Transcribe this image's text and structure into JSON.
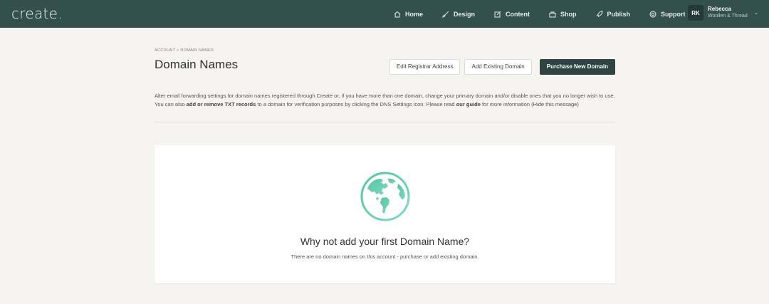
{
  "header": {
    "logo": "create.",
    "nav": [
      {
        "label": "Home",
        "icon": "home-icon"
      },
      {
        "label": "Design",
        "icon": "brush-icon"
      },
      {
        "label": "Content",
        "icon": "edit-icon"
      },
      {
        "label": "Shop",
        "icon": "shop-icon"
      },
      {
        "label": "Publish",
        "icon": "rocket-icon"
      },
      {
        "label": "Support",
        "icon": "support-icon"
      }
    ],
    "user": {
      "initials": "RK",
      "name": "Rebecca",
      "site": "Woollen & Thread"
    }
  },
  "page": {
    "breadcrumb": "ACCOUNT > DOMAIN NAMES",
    "title": "Domain Names",
    "buttons": {
      "edit_registrar": "Edit Registrar Address",
      "add_existing": "Add Existing Domain",
      "purchase_new": "Purchase New Domain"
    },
    "info": {
      "line1": "Alter email forwarding settings for domain names registered through Create or, if you have more than one domain, change your primary domain and/or disable ones that you no longer wish to use.",
      "line2_pre": "You can also ",
      "line2_bold": "add or remove TXT records",
      "line2_mid": " to a domain for verification purposes by clicking the DNS Settings icon. Please read ",
      "line2_link": "our guide",
      "line2_post": " for more information ",
      "hide": "(Hide this message)"
    }
  },
  "empty_state": {
    "title": "Why not add your first Domain Name?",
    "subtitle": "There are no domain names on this account - purchase or add existing domain."
  },
  "colors": {
    "topbar": "#33504c",
    "primary_button": "#2f4442",
    "background": "#f6f4f0",
    "globe_gradient_start": "#4fc3a1",
    "globe_gradient_end": "#7fd6c5"
  }
}
